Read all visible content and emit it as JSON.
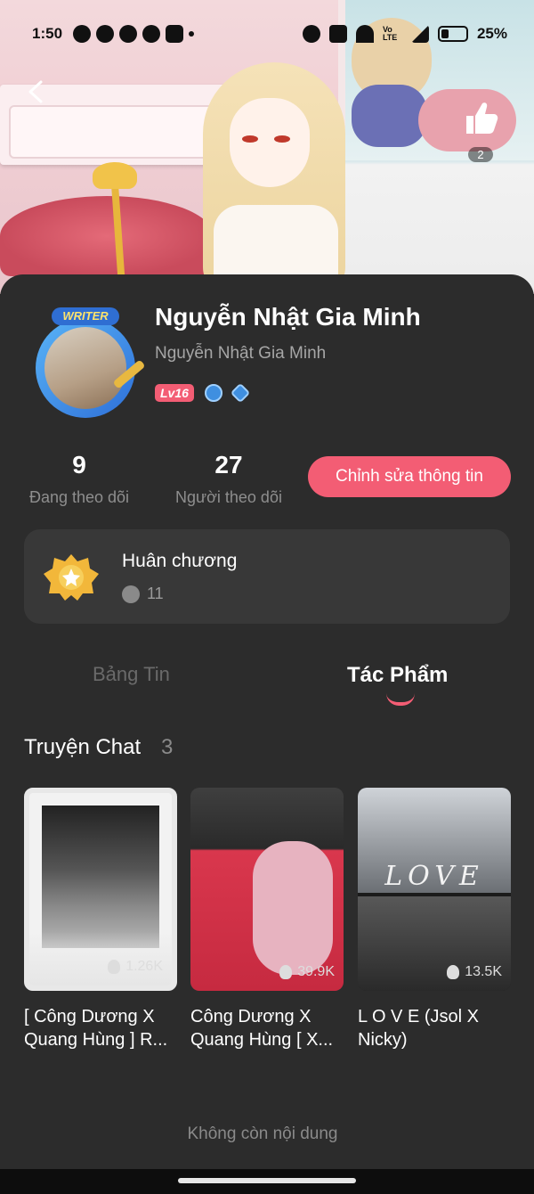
{
  "status_bar": {
    "time": "1:50",
    "battery": "25%",
    "network": "Vo LTE"
  },
  "hero": {
    "like_count": "2"
  },
  "profile": {
    "name": "Nguyễn Nhật Gia Minh",
    "subname": "Nguyễn Nhật Gia Minh",
    "avatar_tag": "WRITER",
    "level": "Lv16"
  },
  "stats": {
    "following_count": "9",
    "following_label": "Đang theo dõi",
    "followers_count": "27",
    "followers_label": "Người theo dõi",
    "edit_button": "Chỉnh sửa thông tin"
  },
  "medal": {
    "title": "Huân chương",
    "count": "11"
  },
  "tabs": [
    {
      "label": "Bảng Tin",
      "active": false
    },
    {
      "label": "Tác Phẩm",
      "active": true
    }
  ],
  "section": {
    "title": "Truyện Chat",
    "count": "3"
  },
  "stories": [
    {
      "title": "[ Công Dương X Quang Hùng ] R...",
      "views": "1.26K"
    },
    {
      "title": "Công Dương X Quang Hùng [ X...",
      "views": "39.9K"
    },
    {
      "title": "L O V E (Jsol X Nicky)",
      "views": "13.5K",
      "cover_text": "LOVE"
    }
  ],
  "footer": {
    "end_text": "Không còn nội dung"
  },
  "colors": {
    "accent": "#f35d74",
    "card_bg": "#2c2c2c",
    "panel_bg": "#383838"
  }
}
